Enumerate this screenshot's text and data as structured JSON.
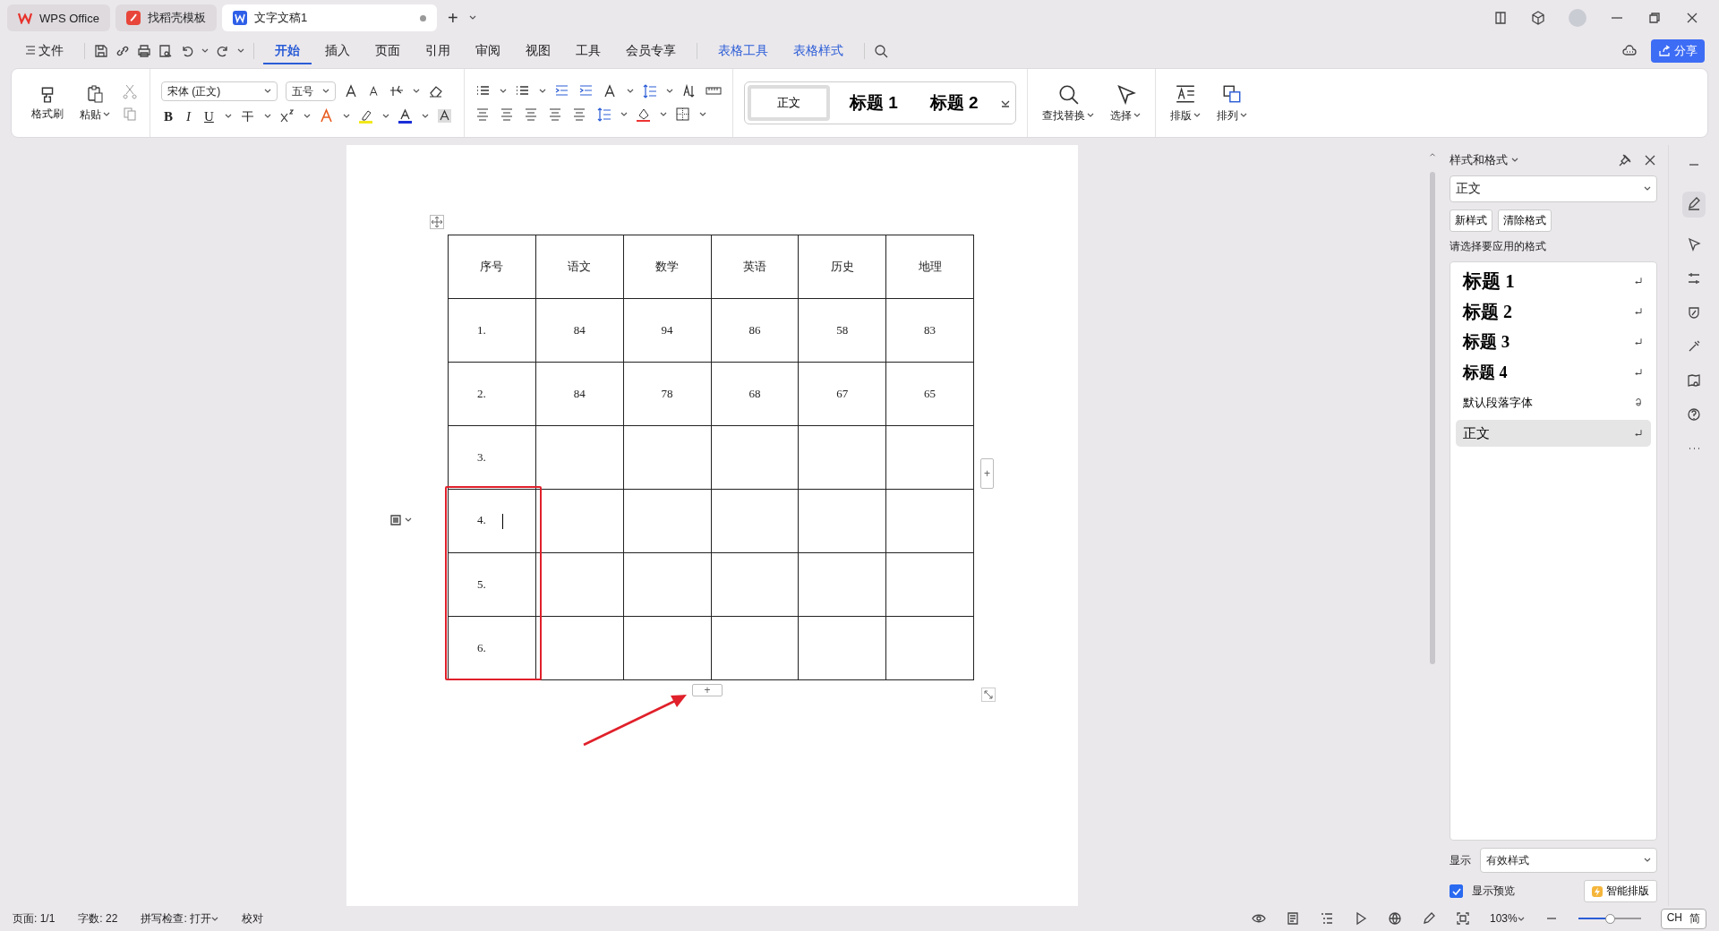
{
  "tabs": [
    {
      "label": "WPS Office",
      "kind": "home",
      "selected": false,
      "modified": false
    },
    {
      "label": "找稻壳模板",
      "kind": "template",
      "selected": false,
      "modified": false
    },
    {
      "label": "文字文稿1",
      "kind": "doc",
      "selected": true,
      "modified": true
    }
  ],
  "menu": {
    "file": "文件",
    "tabs": [
      {
        "label": "开始",
        "selected": true
      },
      {
        "label": "插入",
        "selected": false
      },
      {
        "label": "页面",
        "selected": false
      },
      {
        "label": "引用",
        "selected": false
      },
      {
        "label": "审阅",
        "selected": false
      },
      {
        "label": "视图",
        "selected": false
      },
      {
        "label": "工具",
        "selected": false
      },
      {
        "label": "会员专享",
        "selected": false
      }
    ],
    "context_tabs": [
      {
        "label": "表格工具",
        "selected": false
      },
      {
        "label": "表格样式",
        "selected": false
      }
    ],
    "share": "分享"
  },
  "ribbon": {
    "format_painter": "格式刷",
    "paste": "粘贴",
    "font": "宋体 (正文)",
    "size": "五号",
    "bold": "B",
    "italic": "I",
    "underline": "U",
    "styles": [
      {
        "label": "正文",
        "kind": "body",
        "selected": true
      },
      {
        "label": "标题 1",
        "kind": "heading",
        "selected": false
      },
      {
        "label": "标题 2",
        "kind": "heading",
        "selected": false
      }
    ],
    "find": "查找替换",
    "select": "选择",
    "layout": "排版",
    "arrange": "排列"
  },
  "table": {
    "columns": [
      "序号",
      "语文",
      "数学",
      "英语",
      "历史",
      "地理"
    ],
    "rows": [
      {
        "cells": [
          "1.",
          "84",
          "94",
          "86",
          "58",
          "83"
        ],
        "caret": false,
        "highlighted": false
      },
      {
        "cells": [
          "2.",
          "84",
          "78",
          "68",
          "67",
          "65"
        ],
        "caret": false,
        "highlighted": false
      },
      {
        "cells": [
          "3."
        ],
        "caret": false,
        "highlighted": false
      },
      {
        "cells": [
          "4."
        ],
        "caret": true,
        "highlighted": true
      },
      {
        "cells": [
          "5."
        ],
        "caret": false,
        "highlighted": true
      },
      {
        "cells": [
          "6."
        ],
        "caret": false,
        "highlighted": true
      }
    ],
    "add": "+"
  },
  "panel": {
    "title": "样式和格式",
    "current": "正文",
    "buttons": [
      "新样式",
      "清除格式"
    ],
    "prompt": "请选择要应用的格式",
    "styles": [
      {
        "label": "标题 1",
        "kind": "heading",
        "selected": false
      },
      {
        "label": "标题 2",
        "kind": "heading",
        "selected": false
      },
      {
        "label": "标题 3",
        "kind": "heading",
        "selected": false
      },
      {
        "label": "标题 4",
        "kind": "heading",
        "selected": false
      },
      {
        "label": "默认段落字体",
        "kind": "char",
        "selected": false
      },
      {
        "label": "正文",
        "kind": "para",
        "selected": true
      }
    ],
    "show_label": "显示",
    "show_value": "有效样式",
    "preview": {
      "label": "显示预览",
      "checked": true
    },
    "smart": "智能排版"
  },
  "status": {
    "items": [
      "页面: 1/1",
      "字数: 22",
      "拼写检查: 打开",
      "校对"
    ],
    "zoom": "103%",
    "zoom_slider": {
      "level": 0.5
    },
    "ime": [
      "CH",
      "简"
    ]
  }
}
